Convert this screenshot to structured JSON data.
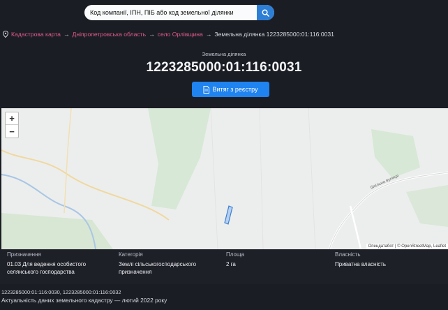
{
  "search": {
    "placeholder": "Код компанії, ІПН, ПІБ або код земельної ділянки"
  },
  "breadcrumb": {
    "root": "Кадастрова карта",
    "region": "Дніпропетровська область",
    "village": "село Орлівщина",
    "current": "Земельна ділянка 1223285000:01:116:0031"
  },
  "plot": {
    "label": "Земельна ділянка",
    "number": "1223285000:01:116:0031"
  },
  "extract_button": "Витяг з реєстру",
  "map": {
    "zoom_in": "+",
    "zoom_out": "−",
    "road_label": "Шкільна вулиця",
    "attribution": "Опендатабот | © OpenStreetMap, Leaflet"
  },
  "info": {
    "purpose": {
      "label": "Призначення",
      "value": "01.03 Для ведення особистого селянського господарства"
    },
    "category": {
      "label": "Категорія",
      "value": "Землі сільськогосподарського призначення"
    },
    "area": {
      "label": "Площа",
      "value": "2 га"
    },
    "ownership": {
      "label": "Власність",
      "value": "Приватна власність"
    }
  },
  "neighbors": "1223285000:01:116:0030, 1223285000:01:116:0032",
  "actuality": "Актуальність даних земельного кадастру — лютий 2022 року",
  "colors": {
    "accent": "#1f83f0",
    "link": "#e05b8c",
    "background": "#1b1d24"
  }
}
